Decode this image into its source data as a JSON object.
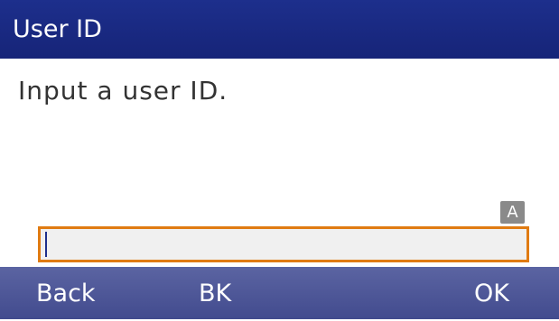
{
  "title_bar": {
    "title": "User ID"
  },
  "main": {
    "prompt": "Input a user ID.",
    "input_mode_badge": "A",
    "user_id_input": {
      "value": "",
      "placeholder": ""
    }
  },
  "softkeys": {
    "back": "Back",
    "bk": "BK",
    "ok": "OK"
  },
  "colors": {
    "title_bar": "#1d2f8c",
    "softkey_bar": "#4c5597",
    "input_border": "#e07b12",
    "input_background": "#f0f0f0",
    "badge": "#8a8a8a"
  }
}
